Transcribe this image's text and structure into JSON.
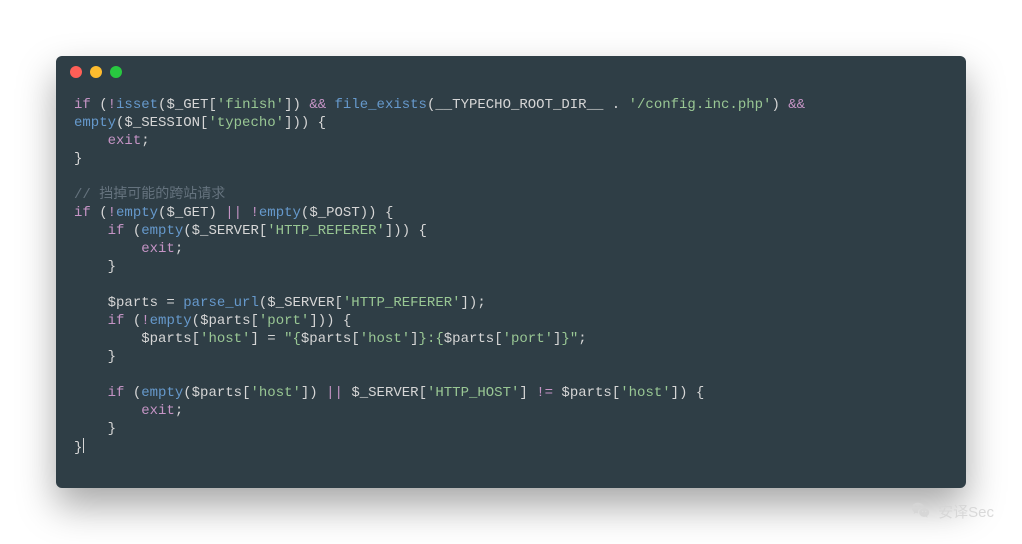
{
  "window": {
    "traffic_lights": {
      "close": "#ff5f57",
      "min": "#febc2e",
      "zoom": "#28c840"
    }
  },
  "code": {
    "comment": "// 挡掉可能的跨站请求",
    "tokens": {
      "if": "if",
      "isset": "isset",
      "file_exists": "file_exists",
      "empty": "empty",
      "parse_url": "parse_url",
      "exit": "exit",
      "and": "&&",
      "or": "||",
      "ne": "!=",
      "not": "!",
      "const_root": "__TYPECHO_ROOT_DIR__",
      "s_finish": "'finish'",
      "s_config": "'/config.inc.php'",
      "s_typecho": "'typecho'",
      "s_referer": "'HTTP_REFERER'",
      "s_port": "'port'",
      "s_host": "'host'",
      "s_http_host": "'HTTP_HOST'",
      "interp_open": "\"{",
      "interp_mid": "}:{"
    },
    "vars": {
      "get": "$_GET",
      "session": "$_SESSION",
      "server": "$_SERVER",
      "post": "$_POST",
      "parts": "$parts"
    }
  },
  "watermark": {
    "text": "安译Sec"
  }
}
